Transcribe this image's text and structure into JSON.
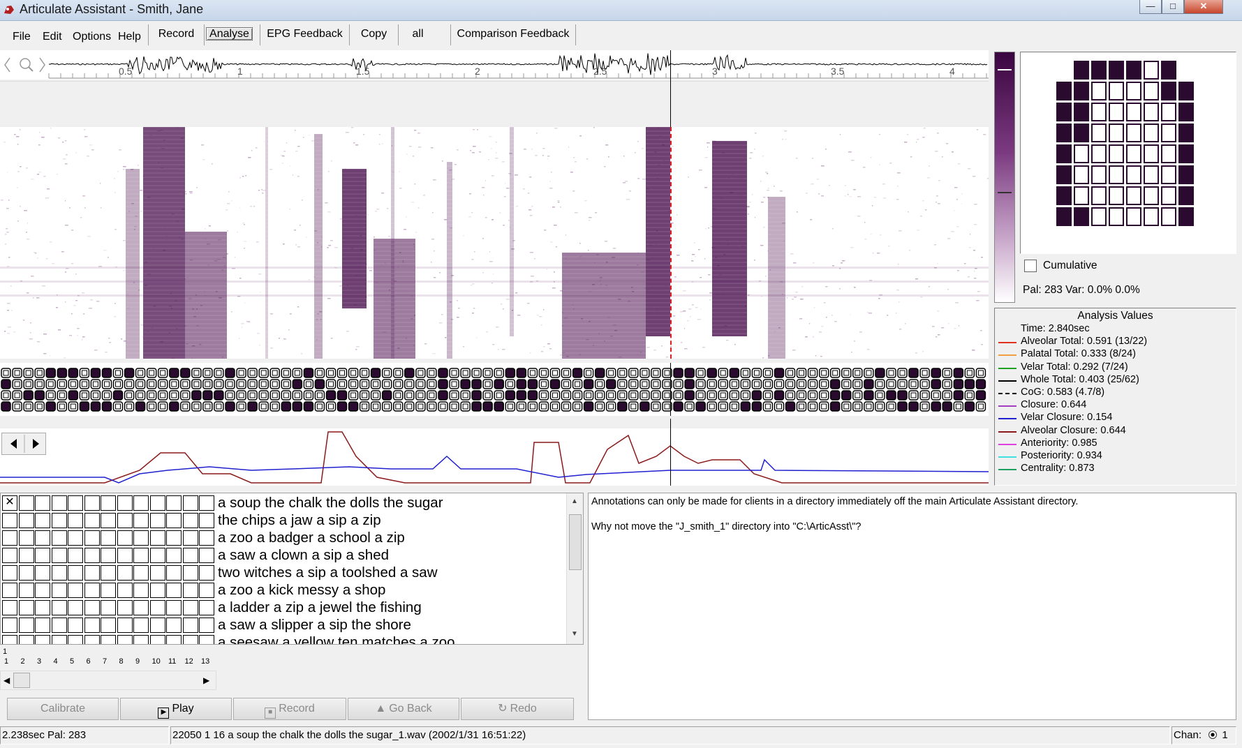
{
  "window": {
    "title": "Articulate Assistant - Smith, Jane",
    "min": "—",
    "max": "□",
    "close": "✕"
  },
  "menu": [
    "File",
    "Edit",
    "Options",
    "Help"
  ],
  "toolbar": [
    "Record",
    "Analyse",
    "EPG Feedback",
    "Copy",
    "all",
    "Comparison Feedback"
  ],
  "waveform": {
    "ticks": [
      "0.5",
      "1",
      "1.5",
      "2",
      "2.5",
      "3",
      "3.5",
      "4"
    ]
  },
  "epg_options": {
    "cumulative_label": "Cumulative",
    "cumulative_checked": false
  },
  "epg_stats": "Pal: 283 Var: 0.0%  0.0%",
  "epg_pattern": [
    [
      1,
      1,
      1,
      1,
      0,
      1
    ],
    [
      1,
      1,
      0,
      0,
      0,
      0,
      1,
      1
    ],
    [
      1,
      1,
      0,
      0,
      0,
      0,
      0,
      1
    ],
    [
      1,
      1,
      0,
      0,
      0,
      0,
      0,
      1
    ],
    [
      1,
      0,
      0,
      0,
      0,
      0,
      0,
      1
    ],
    [
      1,
      0,
      0,
      0,
      0,
      0,
      0,
      1
    ],
    [
      1,
      0,
      0,
      0,
      0,
      0,
      0,
      1
    ],
    [
      1,
      1,
      0,
      0,
      0,
      0,
      0,
      1
    ]
  ],
  "analysis": {
    "title": "Analysis Values",
    "rows": [
      {
        "label": "Time: 2.840sec",
        "color": ""
      },
      {
        "label": "Alveolar Total: 0.591 (13/22)",
        "color": "#e03020"
      },
      {
        "label": "Palatal Total: 0.333 (8/24)",
        "color": "#f0a040"
      },
      {
        "label": "Velar Total: 0.292 (7/24)",
        "color": "#20a020"
      },
      {
        "label": "Whole Total: 0.403 (25/62)",
        "color": "#000000"
      },
      {
        "label": "CoG: 0.583 (4.7/8)",
        "color": "#000000"
      },
      {
        "label": "Closure: 0.644",
        "color": "#a040c0"
      },
      {
        "label": "Velar Closure: 0.154",
        "color": "#2020d0"
      },
      {
        "label": "Alveolar Closure: 0.644",
        "color": "#8b1a1a"
      },
      {
        "label": "Anteriority: 0.985",
        "color": "#e040e0"
      },
      {
        "label": "Posteriority: 0.934",
        "color": "#40e0e0"
      },
      {
        "label": "Centrality: 0.873",
        "color": "#20a060"
      }
    ]
  },
  "word_list": [
    "a soup the chalk the dolls the sugar",
    "the chips  a jaw  a sip  a zip",
    "a zoo  a badger  a school  a zip",
    "a saw  a clown  a sip  a shed",
    "two witches  a sip  a toolshed  a saw",
    "a zoo  a kick  messy  a shop",
    "a ladder  a zip  a jewel  the fishing",
    "a saw  a slipper  a sip  the shore",
    "a seesaw  a yellow  ten matches  a zoo"
  ],
  "column_numbers": [
    "1",
    "2",
    "3",
    "4",
    "5",
    "6",
    "7",
    "8",
    "9",
    "10",
    "11",
    "12",
    "13"
  ],
  "column_top": "1",
  "messages": [
    "Annotations can only be made for clients in a directory immediately off the main Articulate Assistant directory.",
    "Why not move the \"J_smith_1\" directory into \"C:\\ArticAsst\\\"?"
  ],
  "buttons": {
    "calibrate": "Calibrate",
    "play": "Play",
    "record": "Record",
    "go_back": "Go Back",
    "redo": "Redo"
  },
  "status": {
    "left": "2.238sec  Pal: 283",
    "file": "22050 1 16 a soup the chalk the dolls the sugar_1.wav (2002/1/31 16:51:22)",
    "chan_label": "Chan:",
    "chan_value": "1"
  },
  "colors": {
    "accent": "#4a0f4e",
    "alveolar_closure_trace": "#8b1a1a",
    "velar_closure_trace": "#2020d0"
  }
}
